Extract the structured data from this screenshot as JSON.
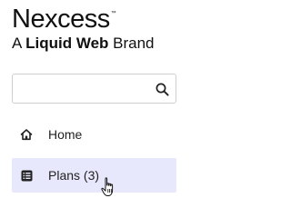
{
  "brand": {
    "name": "Nexcess",
    "trademark": "™",
    "tagline_prefix": "A ",
    "tagline_bold": "Liquid Web",
    "tagline_suffix": " Brand"
  },
  "search": {
    "value": "",
    "placeholder": "",
    "icon": "search-icon"
  },
  "nav": {
    "items": [
      {
        "label": "Home",
        "icon": "home-icon",
        "active": false
      },
      {
        "label": "Plans (3)",
        "icon": "list-icon",
        "active": true
      }
    ]
  },
  "colors": {
    "active_background": "#e7e8fb",
    "text": "#222222"
  }
}
